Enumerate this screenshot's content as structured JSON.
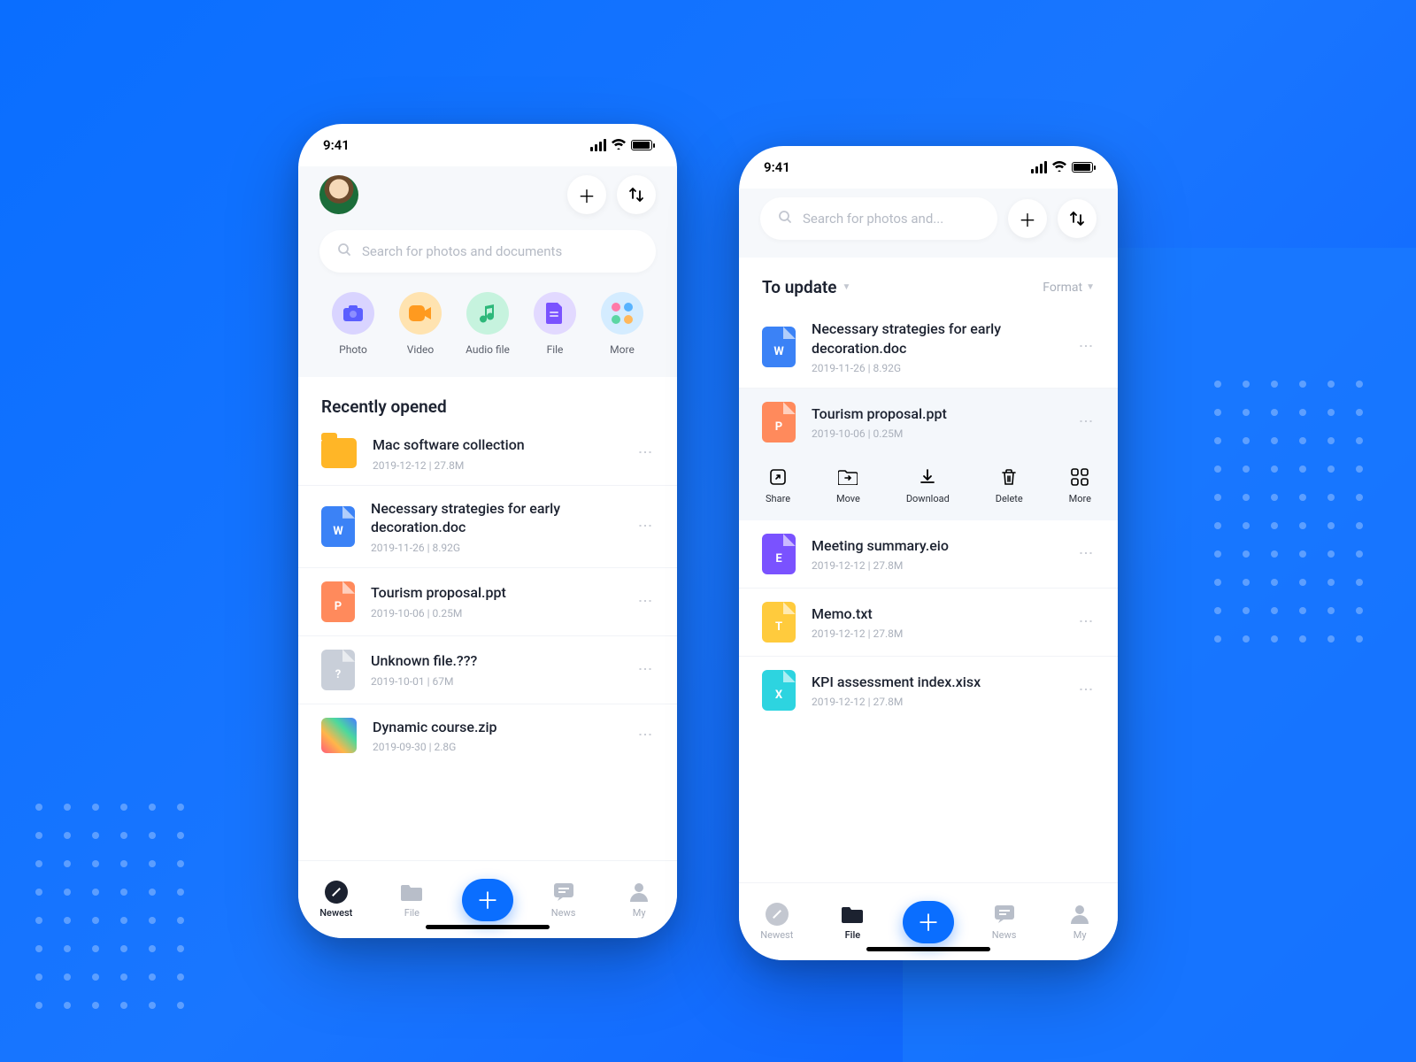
{
  "status": {
    "time": "9:41"
  },
  "search": {
    "placeholder_long": "Search for photos and documents",
    "placeholder_short": "Search for photos and..."
  },
  "categories": [
    {
      "label": "Photo",
      "icon": "photo"
    },
    {
      "label": "Video",
      "icon": "video"
    },
    {
      "label": "Audio file",
      "icon": "audio"
    },
    {
      "label": "File",
      "icon": "file"
    },
    {
      "label": "More",
      "icon": "more"
    }
  ],
  "left": {
    "section_title": "Recently opened",
    "files": [
      {
        "name": "Mac software collection",
        "date": "2019-12-12",
        "size": "27.8M",
        "type": "folder",
        "badge": ""
      },
      {
        "name": "Necessary strategies for early decoration.doc",
        "date": "2019-11-26",
        "size": "8.92G",
        "type": "doc",
        "badge": "W"
      },
      {
        "name": "Tourism proposal.ppt",
        "date": "2019-10-06",
        "size": "0.25M",
        "type": "ppt",
        "badge": "P"
      },
      {
        "name": "Unknown file.???",
        "date": "2019-10-01",
        "size": "67M",
        "type": "unk",
        "badge": "?"
      },
      {
        "name": "Dynamic course.zip",
        "date": "2019-09-30",
        "size": "2.8G",
        "type": "zip",
        "badge": ""
      }
    ]
  },
  "right": {
    "section_title": "To update",
    "format_label": "Format",
    "files": [
      {
        "name": "Necessary strategies for early decoration.doc",
        "date": "2019-11-26",
        "size": "8.92G",
        "type": "doc",
        "badge": "W",
        "selected": false
      },
      {
        "name": "Tourism proposal.ppt",
        "date": "2019-10-06",
        "size": "0.25M",
        "type": "ppt",
        "badge": "P",
        "selected": true
      },
      {
        "name": "Meeting summary.eio",
        "date": "2019-12-12",
        "size": "27.8M",
        "type": "eio",
        "badge": "E",
        "selected": false
      },
      {
        "name": "Memo.txt",
        "date": "2019-12-12",
        "size": "27.8M",
        "type": "txt",
        "badge": "T",
        "selected": false
      },
      {
        "name": "KPI assessment index.xisx",
        "date": "2019-12-12",
        "size": "27.8M",
        "type": "xlsx",
        "badge": "X",
        "selected": false
      }
    ],
    "actions": [
      {
        "label": "Share",
        "icon": "share"
      },
      {
        "label": "Move",
        "icon": "move"
      },
      {
        "label": "Download",
        "icon": "download"
      },
      {
        "label": "Delete",
        "icon": "delete"
      },
      {
        "label": "More",
        "icon": "more"
      }
    ]
  },
  "tabs": [
    {
      "label": "Newest",
      "icon": "newest"
    },
    {
      "label": "File",
      "icon": "file"
    },
    {
      "label": "",
      "icon": "plus"
    },
    {
      "label": "News",
      "icon": "news"
    },
    {
      "label": "My",
      "icon": "my"
    }
  ]
}
